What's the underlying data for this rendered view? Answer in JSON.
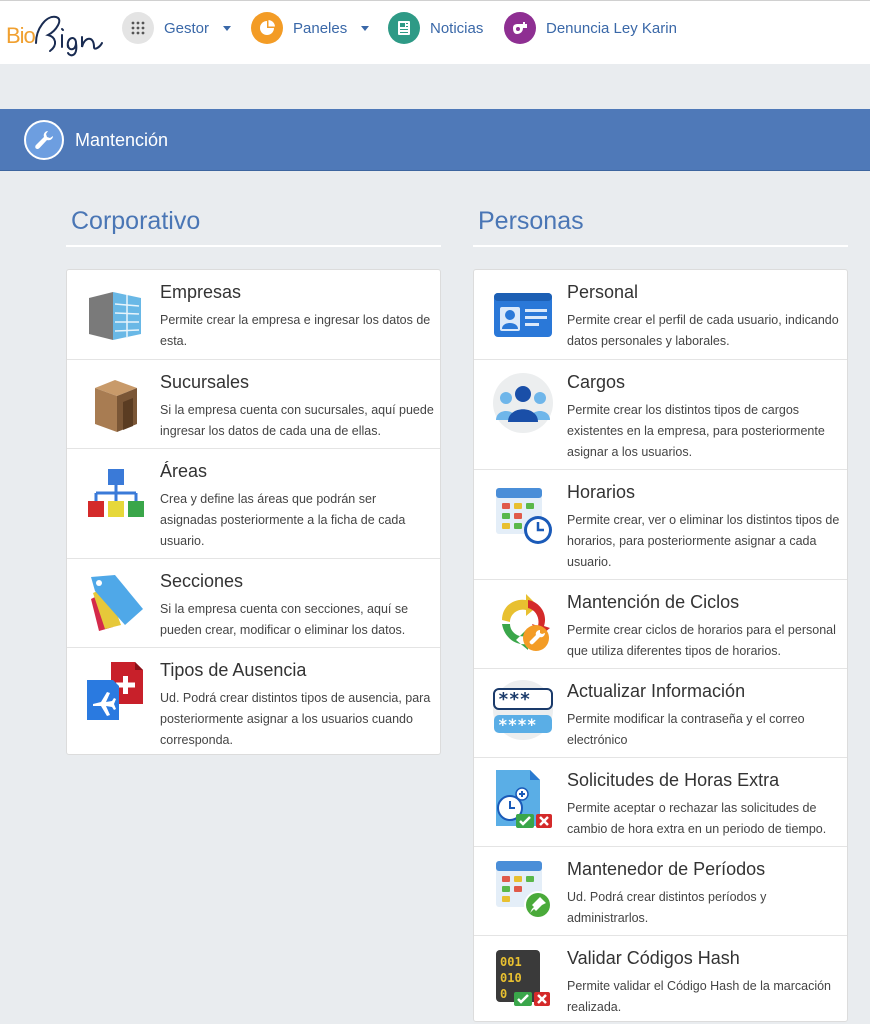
{
  "brand": {
    "logo_prefix": "Bio",
    "logo_script": "Sign"
  },
  "nav": [
    {
      "label": "Gestor",
      "icon": "grid-icon",
      "has_dropdown": true
    },
    {
      "label": "Paneles",
      "icon": "pie-chart-icon",
      "has_dropdown": true
    },
    {
      "label": "Noticias",
      "icon": "newspaper-icon",
      "has_dropdown": false
    },
    {
      "label": "Denuncia Ley Karin",
      "icon": "whistle-icon",
      "has_dropdown": false
    }
  ],
  "banner": {
    "title": "Mantención",
    "icon": "wrench-icon"
  },
  "corporativo": {
    "title": "Corporativo",
    "items": [
      {
        "title": "Empresas",
        "desc": "Permite crear la empresa e ingresar los datos de esta.",
        "icon": "building-icon"
      },
      {
        "title": "Sucursales",
        "desc": "Si la empresa cuenta con sucursales, aquí puede ingresar los datos de cada una de ellas.",
        "icon": "store-icon"
      },
      {
        "title": "Áreas",
        "desc": "Crea y define las áreas que podrán ser asignadas posteriormente a la ficha de cada usuario.",
        "icon": "org-chart-icon"
      },
      {
        "title": "Secciones",
        "desc": "Si la empresa cuenta con secciones, aquí se pueden crear, modificar o eliminar los datos.",
        "icon": "tags-icon"
      },
      {
        "title": "Tipos de Ausencia",
        "desc": "Ud. Podrá crear distintos tipos de ausencia, para posteriormente asignar a los usuarios cuando corresponda.",
        "icon": "absence-icon"
      }
    ]
  },
  "personas": {
    "title": "Personas",
    "items": [
      {
        "title": "Personal",
        "desc": "Permite crear el perfil de cada usuario, indicando datos personales y laborales.",
        "icon": "id-card-icon"
      },
      {
        "title": "Cargos",
        "desc": "Permite crear los distintos tipos de cargos existentes en la empresa, para posteriormente asignar a los usuarios.",
        "icon": "users-icon"
      },
      {
        "title": "Horarios",
        "desc": "Permite crear, ver o eliminar los distintos tipos de horarios, para posteriormente asignar a cada usuario.",
        "icon": "calendar-clock-icon"
      },
      {
        "title": "Mantención de Ciclos",
        "desc": "Permite crear ciclos de horarios para el personal que utiliza diferentes tipos de horarios.",
        "icon": "cycle-icon"
      },
      {
        "title": "Actualizar Información",
        "desc": "Permite modificar la contraseña y el correo electrónico",
        "icon": "password-icon"
      },
      {
        "title": "Solicitudes de Horas Extra",
        "desc": "Permite aceptar o rechazar las solicitudes de cambio de hora extra en un periodo de tiempo.",
        "icon": "overtime-icon"
      },
      {
        "title": "Mantenedor de Períodos",
        "desc": "Ud. Podrá crear distintos períodos y administrarlos.",
        "icon": "calendar-pin-icon"
      },
      {
        "title": "Validar Códigos Hash",
        "desc": "Permite validar el Código Hash de la marcación realizada.",
        "icon": "binary-icon"
      }
    ]
  }
}
